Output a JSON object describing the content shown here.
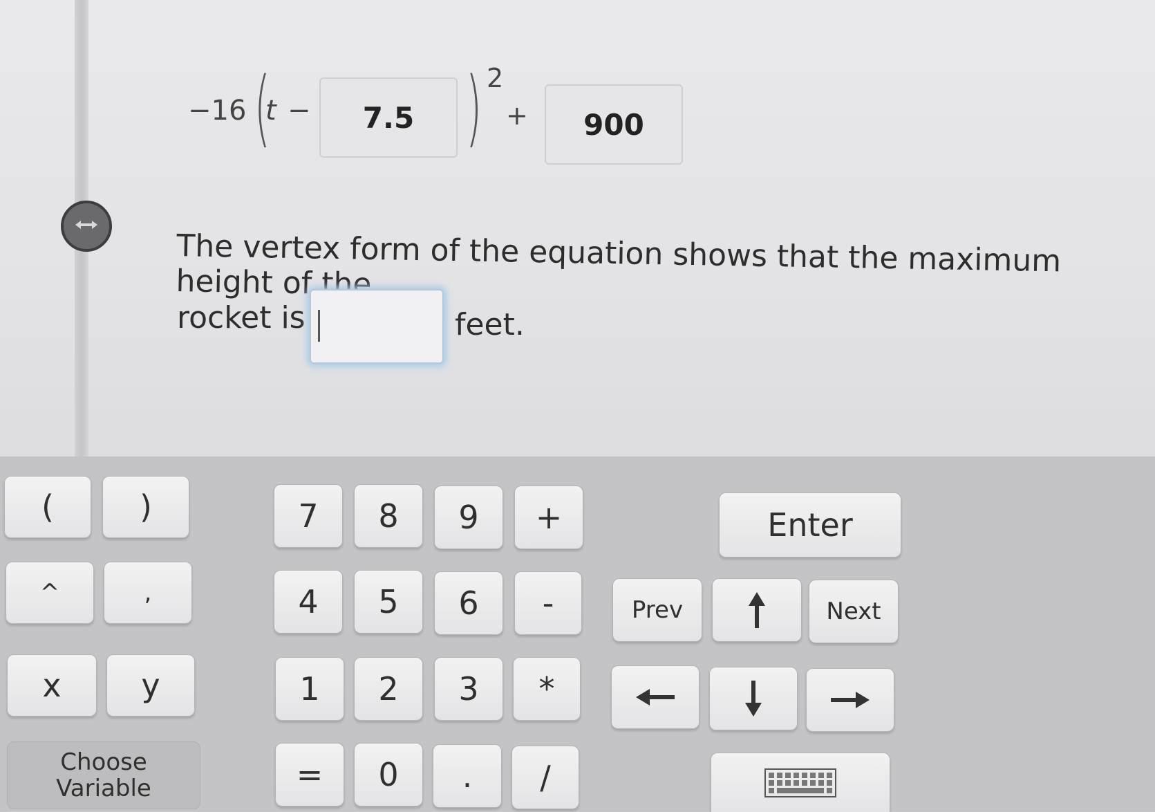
{
  "expression": {
    "coefficient": "−16",
    "left_paren": "(",
    "variable": "t",
    "minus": "−",
    "right_paren": ")",
    "exponent": "2",
    "plus": "+",
    "h_value": "7.5",
    "k_value": "900"
  },
  "question": {
    "line1": "The vertex form of the equation shows that the maximum height of the",
    "line2_prefix": "rocket is",
    "answer_value": "",
    "suffix": "feet."
  },
  "toggle": {
    "icon": "double-arrow-icon"
  },
  "keypad": {
    "open_paren": "(",
    "close_paren": ")",
    "caret": "^",
    "comma": ",",
    "x": "x",
    "y": "y",
    "choose_variable_line1": "Choose",
    "choose_variable_line2": "Variable",
    "digits": {
      "7": "7",
      "8": "8",
      "9": "9",
      "4": "4",
      "5": "5",
      "6": "6",
      "1": "1",
      "2": "2",
      "3": "3",
      "0": "0"
    },
    "plus": "+",
    "minus": "-",
    "times": "*",
    "equals": "=",
    "dot": ".",
    "slash": "/",
    "enter": "Enter",
    "prev": "Prev",
    "next": "Next",
    "icons": {
      "up": "arrow-up-icon",
      "down": "arrow-down-icon",
      "left": "arrow-left-icon",
      "right": "arrow-right-icon",
      "keyboard": "keyboard-icon"
    }
  }
}
